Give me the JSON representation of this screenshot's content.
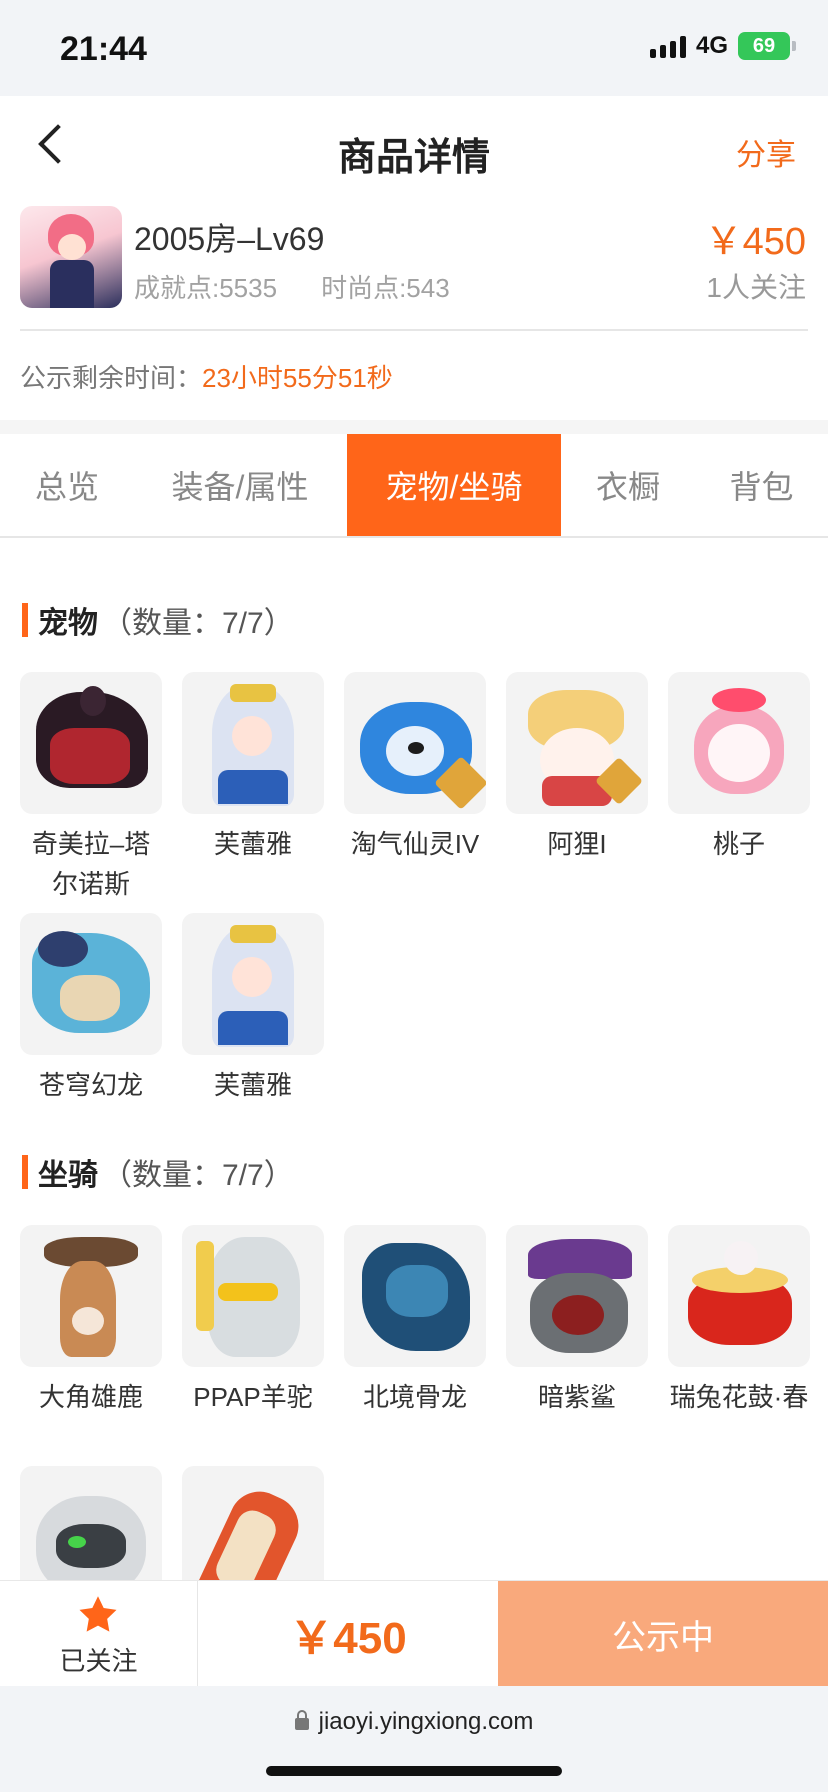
{
  "status_bar": {
    "time": "21:44",
    "network": "4G",
    "battery": "69"
  },
  "header": {
    "title": "商品详情",
    "share": "分享"
  },
  "product": {
    "name": "2005房–Lv69",
    "achievement": "成就点:5535",
    "fashion": "时尚点:543",
    "price": "￥450",
    "followers": "1人关注"
  },
  "countdown": {
    "label": "公示剩余时间：",
    "value": "23小时55分51秒"
  },
  "tabs": [
    "总览",
    "装备/属性",
    "宠物/坐骑",
    "衣橱",
    "背包"
  ],
  "active_tab": "宠物/坐骑",
  "pets": {
    "title": "宠物",
    "count": "（数量：7/7）",
    "items": [
      "奇美拉–塔尔诺斯",
      "芙蕾雅",
      "淘气仙灵IV",
      "阿狸I",
      "桃子",
      "苍穹幻龙",
      "芙蕾雅"
    ]
  },
  "mounts": {
    "title": "坐骑",
    "count": "（数量：7/7）",
    "items": [
      "大角雄鹿",
      "PPAP羊驼",
      "北境骨龙",
      "暗紫鲨",
      "瑞兔花鼓·春"
    ]
  },
  "bottom_bar": {
    "follow_label": "已关注",
    "price": "￥450",
    "status": "公示中"
  },
  "browser": {
    "url": "jiaoyi.yingxiong.com"
  },
  "colors": {
    "accent": "#ff6519",
    "price": "#f26a1b",
    "status_button": "#f9a97c"
  }
}
